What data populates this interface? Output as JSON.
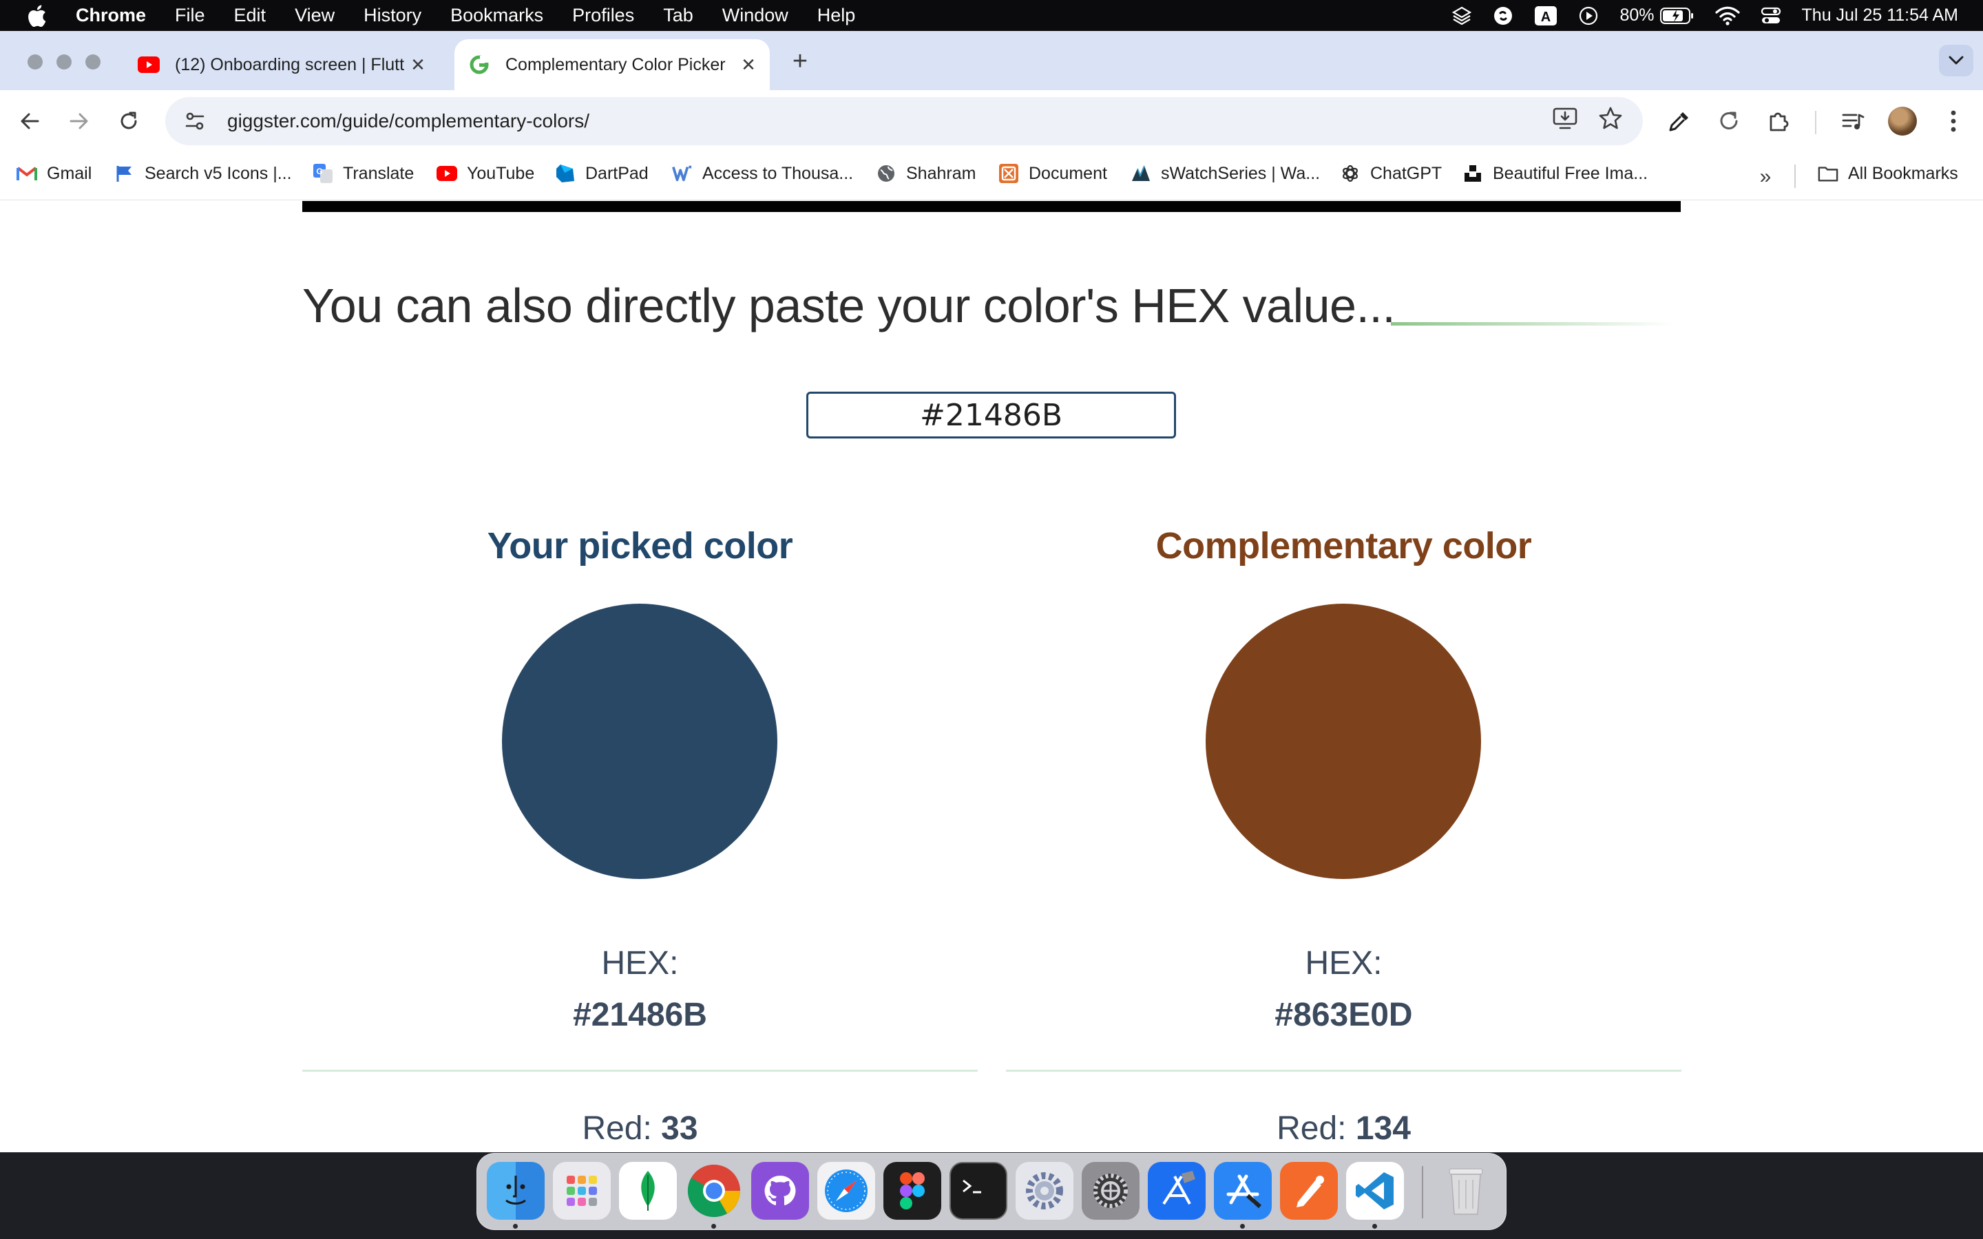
{
  "menubar": {
    "app": "Chrome",
    "items": [
      "File",
      "Edit",
      "View",
      "History",
      "Bookmarks",
      "Profiles",
      "Tab",
      "Window",
      "Help"
    ],
    "battery": "80%",
    "datetime": "Thu Jul 25  11:54 AM"
  },
  "tabs": [
    {
      "title": "(12) Onboarding screen | Flutt",
      "favicon": "youtube-icon",
      "active": false
    },
    {
      "title": "Complementary Color Picker",
      "favicon": "giggster-icon",
      "active": true
    }
  ],
  "toolbar": {
    "url": "giggster.com/guide/complementary-colors/"
  },
  "bookmarks": [
    {
      "label": "Gmail",
      "icon": "gmail-icon"
    },
    {
      "label": "Search v5 Icons |...",
      "icon": "flag-icon"
    },
    {
      "label": "Translate",
      "icon": "translate-icon"
    },
    {
      "label": "YouTube",
      "icon": "youtube-icon"
    },
    {
      "label": "DartPad",
      "icon": "dartpad-icon"
    },
    {
      "label": "Access to Thousa...",
      "icon": "w-icon"
    },
    {
      "label": "Shahram",
      "icon": "globe-icon"
    },
    {
      "label": "Document",
      "icon": "document-icon"
    },
    {
      "label": "sWatchSeries | Wa...",
      "icon": "swatch-icon"
    },
    {
      "label": "ChatGPT",
      "icon": "chatgpt-icon"
    },
    {
      "label": "Beautiful Free Ima...",
      "icon": "unsplash-icon"
    }
  ],
  "all_bookmarks": "All Bookmarks",
  "page": {
    "headline": "You can also directly paste your color's HEX value...",
    "hex_input": "#21486B",
    "picked": {
      "title": "Your picked color",
      "title_color": "#21486b",
      "swatch": "#294866",
      "hex_label": "HEX:",
      "hex": "#21486B",
      "red_label": "Red: ",
      "red": "33"
    },
    "complementary": {
      "title": "Complementary color",
      "title_color": "#7f4119",
      "swatch": "#7d411b",
      "hex_label": "HEX:",
      "hex": "#863E0D",
      "red_label": "Red: ",
      "red": "134"
    }
  },
  "dock": [
    "finder",
    "launchpad",
    "mongodb",
    "chrome",
    "github-desktop",
    "safari",
    "figma",
    "terminal",
    "system-settings-alt",
    "system-settings",
    "xcode",
    "app-store-connect",
    "paw",
    "vscode",
    "trash"
  ]
}
